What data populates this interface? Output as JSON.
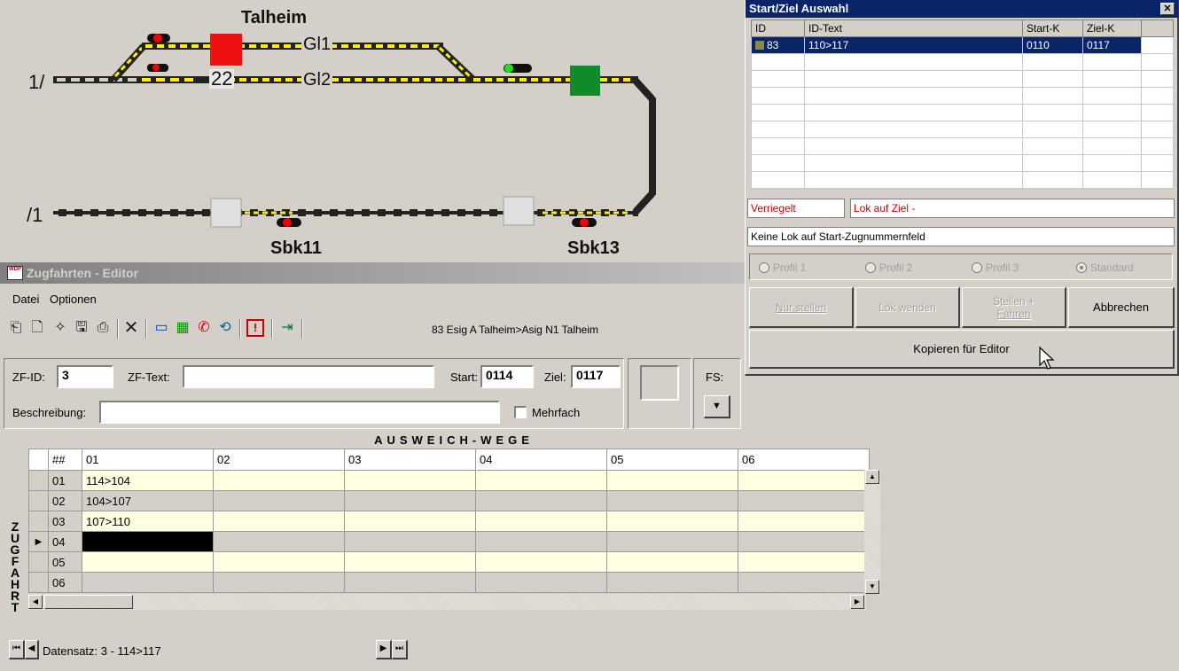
{
  "diagram": {
    "station": "Talheim",
    "line_left_top": "1/",
    "line_left_bottom": "/1",
    "track1": "Gl1",
    "track2": "Gl2",
    "signal_number": "22",
    "block1": "Sbk11",
    "block2": "Sbk13",
    "colors": {
      "red_signal": "#ee1111",
      "green_signal": "#118a2a",
      "yellow": "#ffee00",
      "track": "#222222"
    }
  },
  "editor": {
    "title": "Zugfahrten - Editor",
    "menu": {
      "file": "Datei",
      "options": "Optionen"
    },
    "toolbar": {
      "route_text": "83 Esig A Talheim>Asig N1 Talheim"
    },
    "form": {
      "zf_id_label": "ZF-ID:",
      "zf_id_value": "3",
      "zf_text_label": "ZF-Text:",
      "zf_text_value": "",
      "start_label": "Start:",
      "start_value": "0114",
      "ziel_label": "Ziel:",
      "ziel_value": "0117",
      "fs_label": "FS:",
      "beschreibung_label": "Beschreibung:",
      "beschreibung_value": "",
      "mehrfach_label": "Mehrfach"
    },
    "grid": {
      "title": "AUSWEICH-WEGE",
      "side_label": "ZUGFAHRT",
      "columns": [
        "##",
        "01",
        "02",
        "03",
        "04",
        "05",
        "06"
      ],
      "rows": [
        {
          "num": "01",
          "v01": "114>104"
        },
        {
          "num": "02",
          "v01": "104>107"
        },
        {
          "num": "03",
          "v01": "107>110"
        },
        {
          "num": "04",
          "v01": ""
        },
        {
          "num": "05",
          "v01": ""
        },
        {
          "num": "06",
          "v01": ""
        }
      ]
    },
    "navigator": {
      "record": "Datensatz: 3 - 114>117"
    }
  },
  "dialog": {
    "title": "Start/Ziel Auswahl",
    "columns": {
      "id": "ID",
      "text": "ID-Text",
      "start": "Start-K",
      "ziel": "Ziel-K"
    },
    "rows": [
      {
        "id": "83",
        "text": "110>117",
        "start": "0110",
        "ziel": "0117"
      }
    ],
    "status_locked": "Verriegelt",
    "status_lok_ziel": "Lok auf Ziel -",
    "status_start": "Keine Lok auf Start-Zugnummernfeld",
    "profiles": [
      "Profil 1",
      "Profil 2",
      "Profil 3",
      "Standard"
    ],
    "buttons": {
      "nur_stellen": "Nur stellen",
      "lok_wenden": "Lok wenden",
      "stellen_fahren_1": "Stellen +",
      "stellen_fahren_2": "Fahren",
      "abbrechen": "Abbrechen",
      "kopieren": "Kopieren für Editor"
    }
  }
}
